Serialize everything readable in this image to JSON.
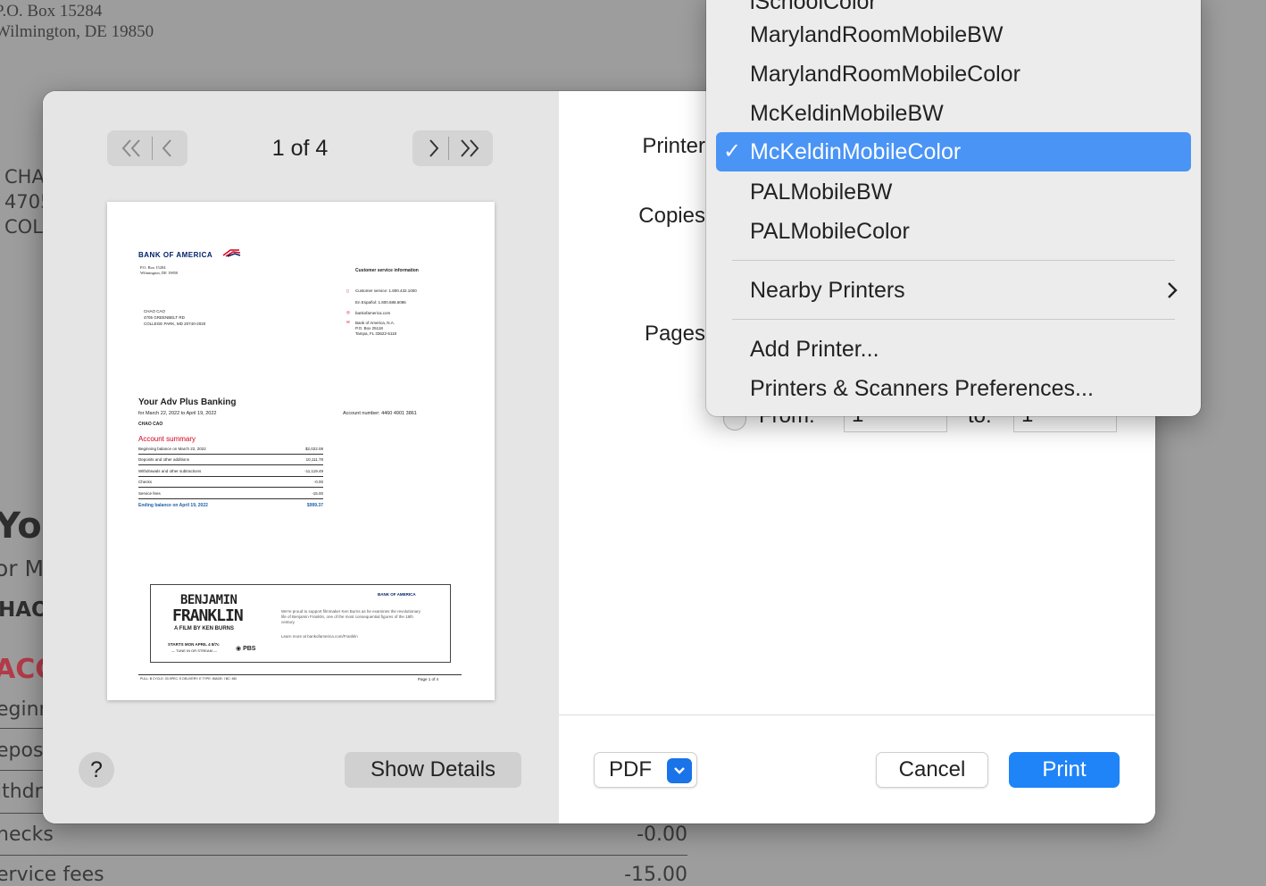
{
  "background_document": {
    "return_address": [
      "P.O. Box 15284",
      "Wilmington, DE 19850"
    ],
    "customer_fragments": [
      "CHA",
      "4705",
      "COL"
    ],
    "heading_fragment": "You",
    "subheading_fragment": "or M",
    "name_fragment": "HAO",
    "section_fragment": "ACC",
    "rows": [
      {
        "label": "eginn",
        "value": ""
      },
      {
        "label": "eposi",
        "value": ""
      },
      {
        "label": "ithdr",
        "value": ""
      },
      {
        "label": "hecks",
        "value": "-0.00"
      },
      {
        "label": "ervice fees",
        "value": "-15.00"
      }
    ]
  },
  "dialog": {
    "page_counter": "1 of 4",
    "help_label": "?",
    "show_details_label": "Show Details",
    "fields": {
      "printer_label": "Printer",
      "copies_label": "Copies",
      "pages_label": "Pages",
      "from_label": "From:",
      "from_value": "1",
      "to_label": "to:",
      "to_value": "1"
    },
    "pdf_label": "PDF",
    "cancel_label": "Cancel",
    "print_label": "Print"
  },
  "preview": {
    "bank_name": "BANK OF AMERICA",
    "address": [
      "P.O. Box 15284",
      "Wilmington, DE 19850"
    ],
    "customer": [
      "CHAO CAO",
      "4705 GREENBELT RD",
      "COLLEGE PARK, MD 20740-2020"
    ],
    "service_title": "Customer service information",
    "service_lines": [
      "Customer service: 1.800.432.1000",
      "En Español: 1.800.688.6086",
      "bankofamerica.com",
      "Bank of America, N.A.",
      "P.O. Box 25118",
      "Tampa, FL 33622-5118"
    ],
    "account_title": "Your Adv Plus Banking",
    "period": "for March 22, 2022 to April 19, 2022",
    "account_number": "Account number: 4460 4901 3861",
    "owner": "CHAO CAO",
    "summary_title": "Account summary",
    "summary_rows": [
      {
        "label": "Beginning balance on March 22, 2022",
        "value": "$2,022.08"
      },
      {
        "label": "Deposits and other additions",
        "value": "10,111.78"
      },
      {
        "label": "Withdrawals and other subtractions",
        "value": "-11,119.49"
      },
      {
        "label": "Checks",
        "value": "-0.00"
      },
      {
        "label": "Service fees",
        "value": "-15.00"
      }
    ],
    "ending_label": "Ending balance on April 19, 2022",
    "ending_value": "$999.37",
    "ad_title_1": "BENJAMIN",
    "ad_title_2": "FRANKLIN",
    "ad_subtitle": "A FILM BY KEN BURNS",
    "ad_starts": "STARTS MON APRIL 4 8/7c",
    "ad_tune": "— TUNE IN OR STREAM —",
    "ad_pbs": "PBS",
    "ad_text": "We're proud to support filmmaker Ken Burns as he examines the revolutionary life of Benjamin Franklin, one of the most consequential figures of the 18th century.",
    "ad_link": "Learn more at bankofamerica.com/Franklin",
    "footer_left": "PULL: B  CYCLE: 33  SPEC: E  DELIVERY: E  TYPE:  IMAGE: I  BC: MD",
    "footer_right": "Page 1 of 4"
  },
  "printer_menu": {
    "partial_item": "iSchoolColor",
    "items": [
      {
        "label": "MarylandRoomMobileBW",
        "selected": false
      },
      {
        "label": "MarylandRoomMobileColor",
        "selected": false
      },
      {
        "label": "McKeldinMobileBW",
        "selected": false
      },
      {
        "label": "McKeldinMobileColor",
        "selected": true
      },
      {
        "label": "PALMobileBW",
        "selected": false
      },
      {
        "label": "PALMobileColor",
        "selected": false
      }
    ],
    "nearby_label": "Nearby Printers",
    "add_printer_label": "Add Printer...",
    "preferences_label": "Printers & Scanners Preferences...",
    "check_glyph": "✓"
  },
  "colors": {
    "accent": "#1f84f7",
    "selection": "#4a94f6",
    "bank_red": "#d4001a",
    "bank_blue": "#012169"
  }
}
